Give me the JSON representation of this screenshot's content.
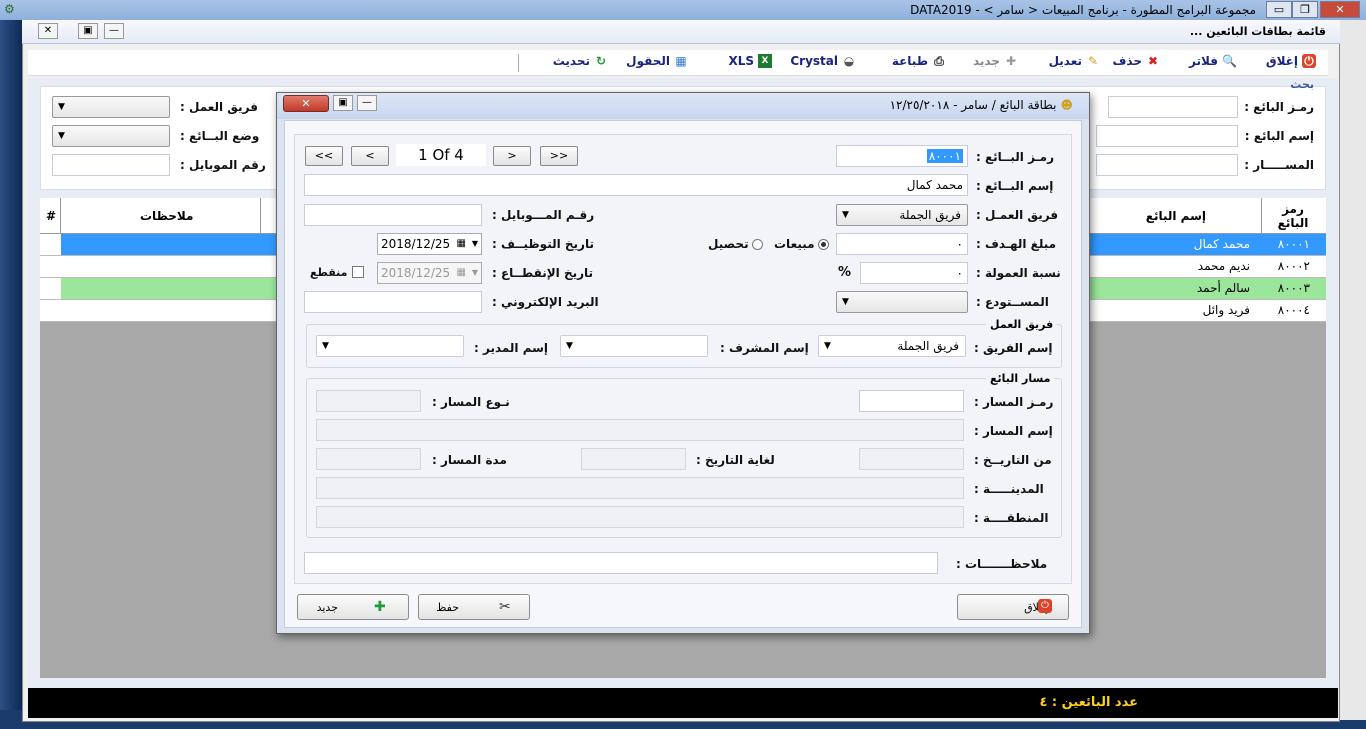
{
  "os": {
    "title": "مجموعة البرامج المطورة - برنامج المبيعات < سامر > - DATA2019",
    "min": "▭",
    "max": "❐",
    "close": "✕"
  },
  "inner": {
    "title": "قائمة بطاقات البائعين ..."
  },
  "toolbar": {
    "close": "إغلاق",
    "filters": "فلاتر",
    "delete": "حذف",
    "edit": "تعديل",
    "new": "جديد",
    "print": "طباعة",
    "crystal": "Crystal",
    "xls": "XLS",
    "fields": "الحقول",
    "refresh": "تحديث"
  },
  "search": {
    "title": "بحث",
    "seller_code": "رمـز البائع :",
    "seller_name": "إسم البائع :",
    "route": "المســـــار :",
    "team": "فريق العمل :",
    "seller_status": "وضع البــائع :",
    "mobile": "رقم الموبايل :"
  },
  "grid": {
    "headers": {
      "code": "رمز البائع",
      "name": "إسم البائع",
      "notes": "ملاحظات",
      "hash": "#"
    },
    "rows": [
      {
        "code": "٨٠٠٠١",
        "name": "محمد كمال"
      },
      {
        "code": "٨٠٠٠٢",
        "name": "نديم محمد"
      },
      {
        "code": "٨٠٠٠٣",
        "name": "سالم أحمد"
      },
      {
        "code": "٨٠٠٠٤",
        "name": "فريد وائل"
      }
    ]
  },
  "status": {
    "text": "عدد البائعين : ٤"
  },
  "dialog": {
    "title": "بطاقة البائع / سامر - ١٢/٢٥/٢٠١٨",
    "nav": {
      "first": "<<",
      "prev": "<",
      "next": ">",
      "last": ">>",
      "counter": "1  Of  4"
    },
    "labels": {
      "seller_code": "رمـز البــائع :",
      "seller_name": "إسم البــائع :",
      "team": "فريق العمـل :",
      "target": "مبلغ الهـدف :",
      "commission": "نسبة العمولة :",
      "warehouse": "المســتودع :",
      "mobile": "رقـم المـــوبايل :",
      "hire_date": "تاريخ التوظيــف :",
      "end_date": "تاريخ الإنقطــاع :",
      "email": "البريد الإلكتروني :",
      "sales": "مبيعات",
      "collection": "تحصيل",
      "percent": "%",
      "discontinued": "منقطع"
    },
    "values": {
      "seller_code": "٨٠٠٠١",
      "seller_name": "محمد كمال",
      "team": "فريق الجملة",
      "target": "٠",
      "commission": "٠",
      "hire_date": "2018/12/25",
      "end_date": "2018/12/25"
    },
    "team_group": {
      "title": "فريق العمل",
      "team_name": "إسم الفريق :",
      "team_value": "فريق الجملة",
      "supervisor": "إسم المشرف :",
      "manager": "إسم المدير :"
    },
    "route_group": {
      "title": "مسار البائع",
      "route_code": "رمـز المسار :",
      "route_type": "نـوع المسار :",
      "route_name": "إسم المسار :",
      "from_date": "من التاريــخ :",
      "to_date": "لغاية التاريخ :",
      "duration": "مدة المسار :",
      "city": "المدينـــــة :",
      "region": "المنطقــــة :"
    },
    "notes": "ملاحظـــــــات :",
    "buttons": {
      "close": "إغلاق",
      "save": "حفظ",
      "new": "جديد"
    }
  },
  "colors": {
    "selected_row": "#3399ff",
    "green_row": "#9be69b",
    "status_text": "#ffd21a"
  }
}
